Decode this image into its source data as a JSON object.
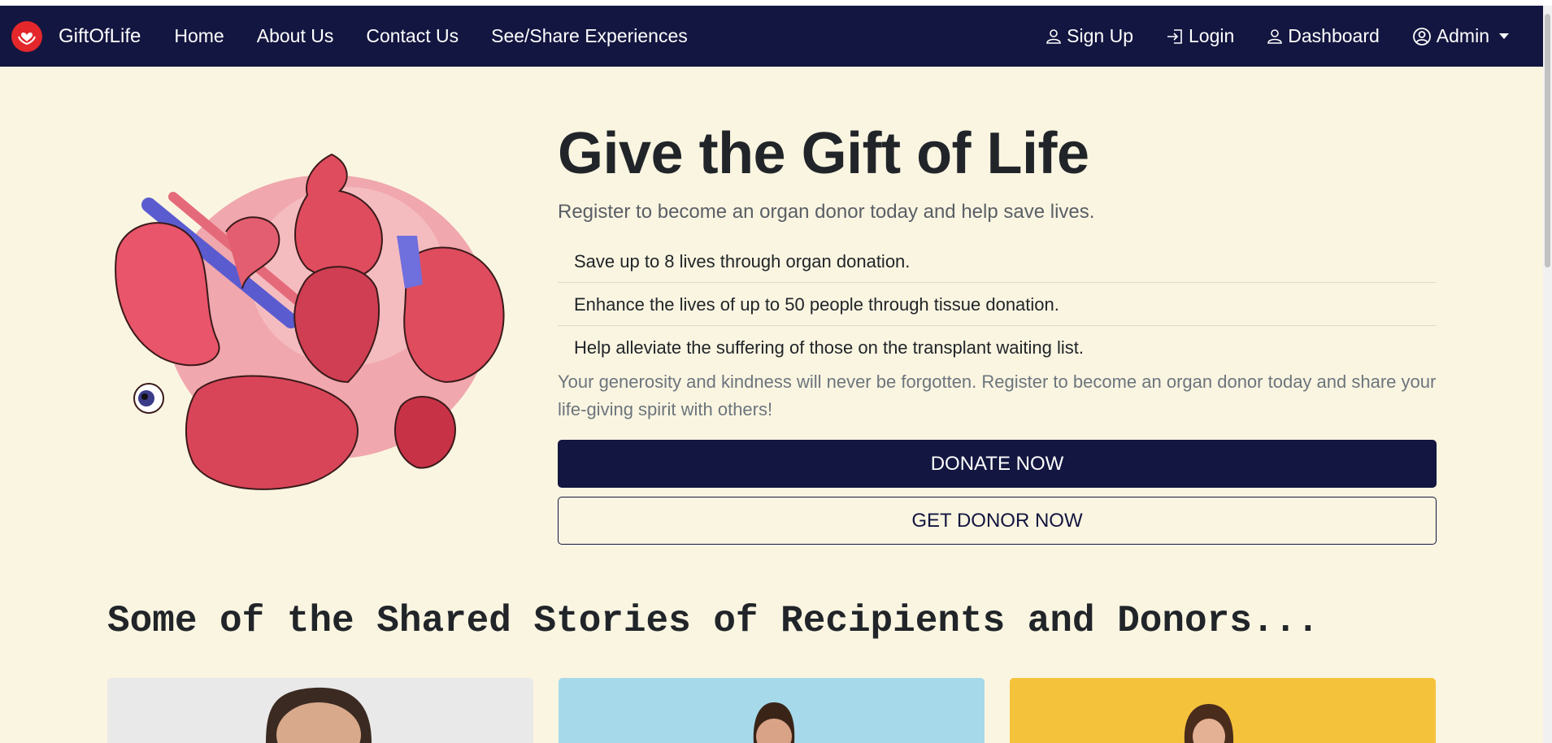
{
  "navbar": {
    "brand": "GiftOfLife",
    "brand_icon": "heart-hands-icon",
    "left_links": [
      "Home",
      "About Us",
      "Contact Us",
      "See/Share Experiences"
    ],
    "sign_up": "Sign Up",
    "login": "Login",
    "dashboard": "Dashboard",
    "admin": "Admin"
  },
  "hero": {
    "image": "organs-illustration",
    "title": "Give the Gift of Life",
    "subtitle": "Register to become an organ donor today and help save lives.",
    "benefits": [
      "Save up to 8 lives through organ donation.",
      "Enhance the lives of up to 50 people through tissue donation.",
      "Help alleviate the suffering of those on the transplant waiting list."
    ],
    "closing": "Your generosity and kindness will never be forgotten. Register to become an organ donor today and share your life-giving spirit with others!",
    "donate_button": "DONATE NOW",
    "donor_button": "GET DONOR NOW"
  },
  "stories": {
    "title": "Some of the Shared Stories of Recipients and Donors...",
    "cards": [
      {
        "image": "man-portrait",
        "background": "#e9e9e9"
      },
      {
        "image": "woman-portrait",
        "background": "#a6d9ea"
      },
      {
        "image": "woman-portrait",
        "background": "#f5c23c"
      }
    ]
  },
  "colors": {
    "navbar": "#131640",
    "page_background": "#faf5e1",
    "brand_logo": "#e3272b",
    "primary_button": "#131640"
  }
}
